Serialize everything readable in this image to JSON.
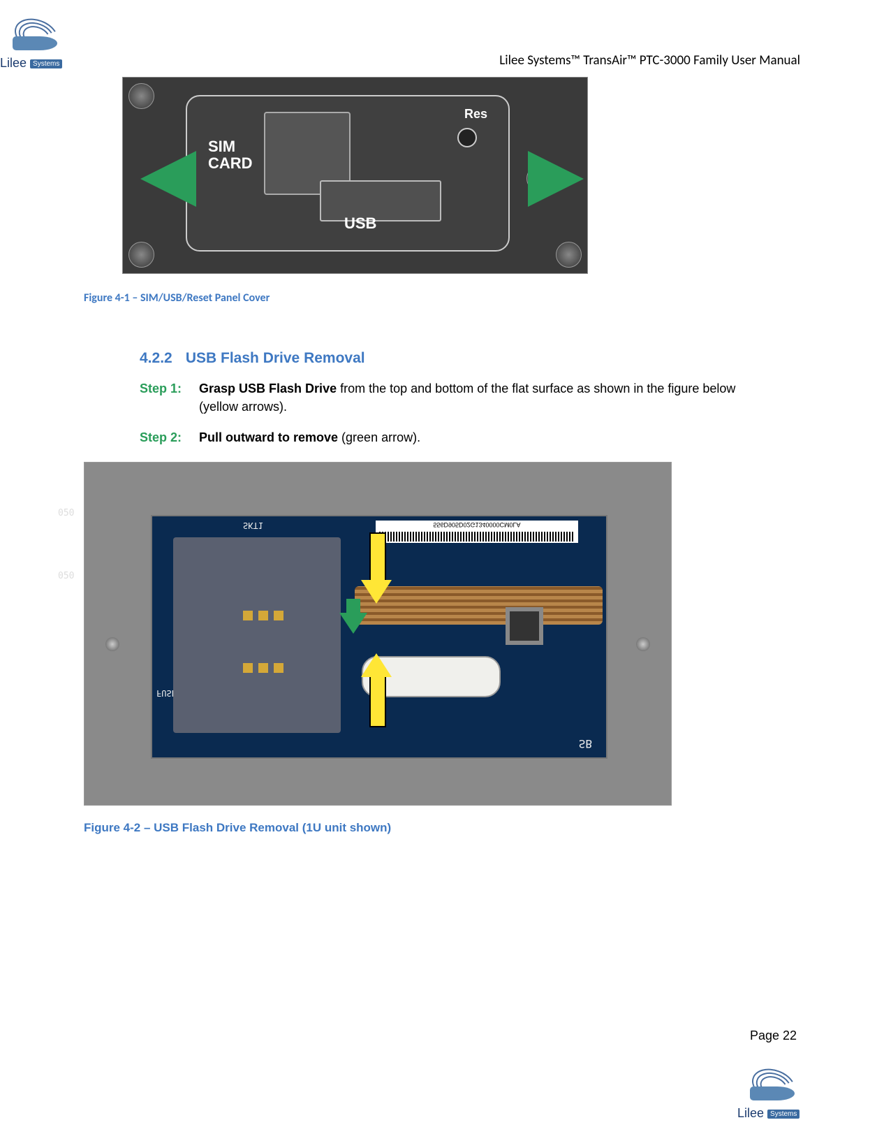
{
  "header": {
    "title": "Lilee Systems™ TransAir™ PTC-3000 Family User Manual",
    "logo_text": "Lilee",
    "logo_badge": "Systems"
  },
  "figure1": {
    "caption": "Figure 4-1 – SIM/USB/Reset Panel Cover",
    "labels": {
      "sim": "SIM\nCARD",
      "usb": "USB",
      "reset": "Res"
    }
  },
  "section": {
    "number": "4.2.2",
    "title": "USB Flash Drive Removal"
  },
  "steps": [
    {
      "label": "Step 1:",
      "bold": "Grasp USB Flash Drive",
      "rest": " from the top and bottom of the flat surface as shown in the figure below (yellow arrows)."
    },
    {
      "label": "Step 2:",
      "bold": "Pull outward to remove",
      "rest": " (green arrow)."
    }
  ],
  "figure2": {
    "caption": "Figure 4-2 – USB Flash Drive Removal (1U unit shown)",
    "pcb_labels": {
      "skt": "SKT1",
      "d050": "050",
      "fuse": "FUSE",
      "sb": "SB",
      "barcode_text": "556D905D02G1340000CM0LA"
    }
  },
  "footer": {
    "page": "Page 22",
    "logo_text": "Lilee",
    "logo_badge": "Systems"
  }
}
